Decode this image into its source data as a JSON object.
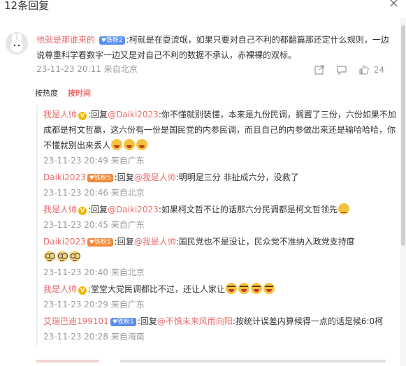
{
  "header": {
    "title": "12条回复",
    "close_icon": "×"
  },
  "main_comment": {
    "username": "他就是那谁来的",
    "badge": "铁粉2",
    "text": ":柯就是在耍流氓，如果只要对自己不利的都翻篇那还定什么规则，一边说尊重科学看数字一边又是对自己不利的数据不承认，赤裸裸的双标。",
    "time": "23-11-23 20:11",
    "location": "来自北京",
    "likes": "24"
  },
  "sort": {
    "hot_label": "按热度",
    "time_label": "按时间"
  },
  "replies": [
    {
      "username": "我是人帅",
      "verified": true,
      "badge": "",
      "reply_prefix": ":回复",
      "mention": "@Daiki2023",
      "text": ":你不懂就别装懂，本来是九份民调，搁置了三份，六份如果不加成都是柯文哲赢，这六份有一份是国民党的内参民调，而且自己的内参做出来还是输哈哈哈，你不懂就别出来丢人",
      "emojis": [
        "laugh",
        "laugh",
        "laugh"
      ],
      "time": "23-11-23 20:49",
      "location": "来自广东"
    },
    {
      "username": "Daiki2023",
      "verified": false,
      "badge": "铁粉5",
      "reply_prefix": ":回复",
      "mention": "@我是人帅",
      "text": ":明明是三分 非扯成六分，没救了",
      "emojis": [],
      "time": "23-11-23 20:46",
      "location": "来自北京"
    },
    {
      "username": "我是人帅",
      "verified": true,
      "badge": "",
      "reply_prefix": ":回复",
      "mention": "@Daiki2023",
      "text": ":如果柯文哲不让的话那六分民调都是柯文哲领先",
      "emojis": [
        "ok"
      ],
      "time": "23-11-23 20:45",
      "location": "来自广东"
    },
    {
      "username": "Daiki2023",
      "verified": false,
      "badge": "铁粉5",
      "reply_prefix": ":回复",
      "mention": "@我是人帅",
      "text": ":国民党也不是没让，民众党不准纳入政党支持度",
      "emojis": [
        "glasses",
        "glasses",
        "glasses"
      ],
      "time": "23-11-23 20:40",
      "location": "来自北京"
    },
    {
      "username": "我是人帅",
      "verified": true,
      "badge": "",
      "reply_prefix": "",
      "mention": "",
      "text": ":堂堂大党民调都比不过，还让人家让",
      "emojis": [
        "cry",
        "cry",
        "cry",
        "cry"
      ],
      "time": "23-11-23 20:29",
      "location": "来自广东"
    },
    {
      "username": "艾瑞巴迪199101",
      "verified": false,
      "badge": "铁粉1",
      "reply_prefix": ":回复",
      "mention": "@不慎未来风雨向阳",
      "text": ":按统计误差内算候得一点的话是候6:0柯",
      "emojis": [],
      "time": "23-11-23 20:28",
      "location": "来自海南"
    }
  ],
  "colors": {
    "accent": "#e86b6b",
    "meta": "#999999",
    "badge_blue": "#5b8ef0",
    "badge_orange": "#f08a3c"
  }
}
